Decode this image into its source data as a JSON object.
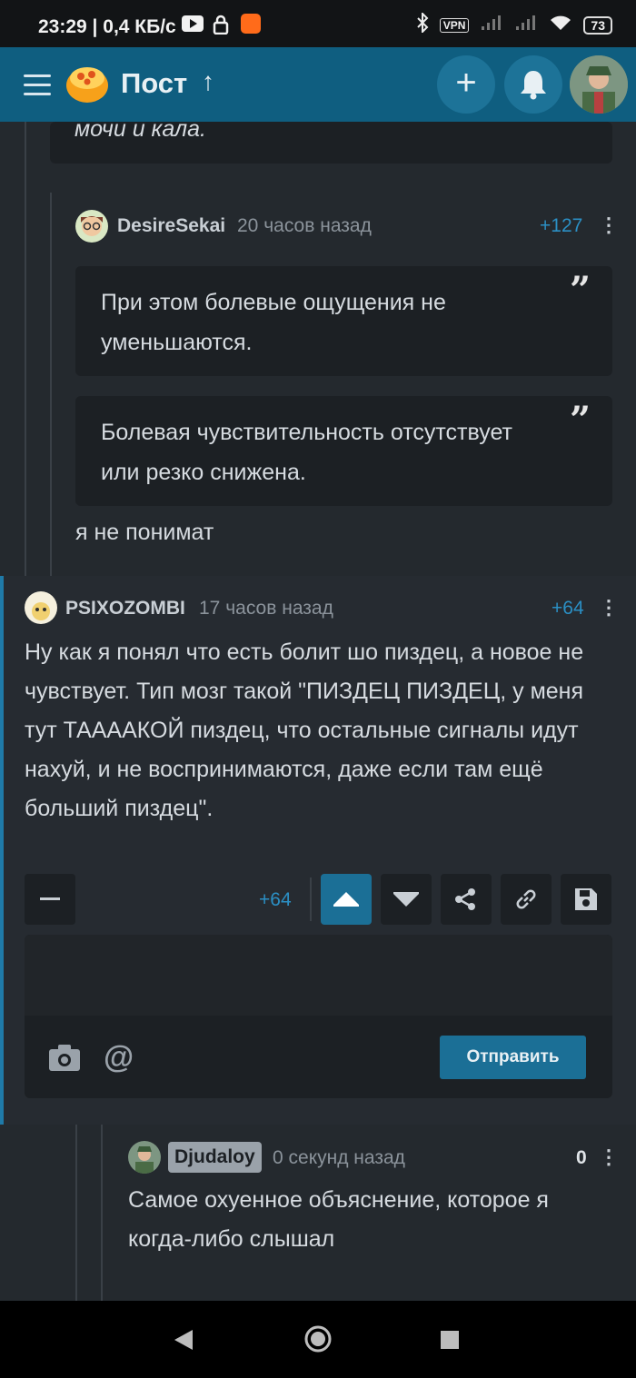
{
  "status_bar": {
    "time": "23:29",
    "speed": "0,4 КБ/с",
    "vpn": "VPN",
    "battery": "73"
  },
  "header": {
    "title": "Пост",
    "up_arrow": "↑"
  },
  "comments": [
    {
      "tail_text": "мочи и кала."
    },
    {
      "user": "DesireSekai",
      "time": "20 часов назад",
      "score": "+127",
      "quotes": [
        "При этом болевые ощущения не уменьшаются.",
        "Болевая чувствительность отсутствует или резко снижена."
      ],
      "text": "я не понимат"
    },
    {
      "user": "PSIXOZOMBI",
      "time": "17 часов назад",
      "score": "+64",
      "text": "Ну как я понял что есть болит шо пиздец, а новое не чувствует. Тип мозг такой \"ПИЗДЕЦ ПИЗДЕЦ, у меня тут ТААААКОЙ пиздец, что остальные сигналы идут нахуй, и не воспринимаются, даже если там ещё больший пиздец\".",
      "action_score": "+64",
      "send_label": "Отправить"
    },
    {
      "user": "Djudaloy",
      "time": "0 секунд назад",
      "score": "0",
      "text": "Самое охуенное объяснение, которое я когда-либо слышал"
    }
  ],
  "colors": {
    "accent": "#0f5e80",
    "score": "#2b8fc4",
    "bg": "#24292e",
    "card": "#1c2024"
  }
}
